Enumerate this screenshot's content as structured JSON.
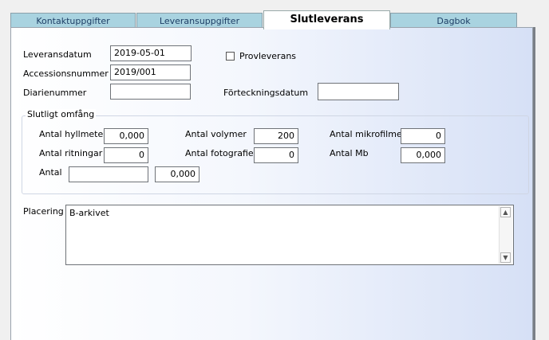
{
  "tabs": [
    {
      "label": "Kontaktuppgifter"
    },
    {
      "label": "Leveransuppgifter"
    },
    {
      "label": "Slutleverans"
    },
    {
      "label": "Dagbok"
    }
  ],
  "form": {
    "leveransdatum_label": "Leveransdatum",
    "leveransdatum_value": "2019-05-01",
    "accessionsnummer_label": "Accessionsnummer",
    "accessionsnummer_value": "2019/001",
    "diarienummer_label": "Diarienummer",
    "diarienummer_value": "",
    "provleverans_label": "Provleverans",
    "forteckningsdatum_label": "Förteckningsdatum",
    "forteckningsdatum_value": ""
  },
  "omfang": {
    "title": "Slutligt omfång",
    "hyllmeter_label": "Antal hyllmeter",
    "hyllmeter_value": "0,000",
    "volymer_label": "Antal volymer",
    "volymer_value": "200",
    "mikrofilmer_label": "Antal mikrofilmer",
    "mikrofilmer_value": "0",
    "ritningar_label": "Antal ritningar",
    "ritningar_value": "0",
    "fotografier_label": "Antal fotografier",
    "fotografier_value": "0",
    "mb_label": "Antal Mb",
    "mb_value": "0,000",
    "antal_label": "Antal",
    "antal_unit_value": "",
    "antal_value": "0,000"
  },
  "placering": {
    "label": "Placering",
    "value": "B-arkivet"
  }
}
